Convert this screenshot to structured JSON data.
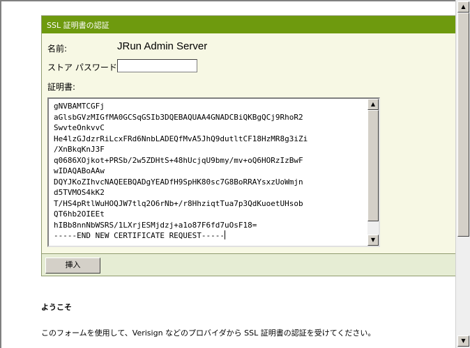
{
  "panel": {
    "title": "SSL 証明書の認証",
    "name_label": "名前:",
    "name_value": "JRun Admin Server",
    "password_label": "ストア パスワード:",
    "password_value": "",
    "certificate_label": "証明書:",
    "certificate_lines": [
      "gNVBAMTCGFj",
      "aGlsbGVzMIGfMA0GCSqGSIb3DQEBAQUAA4GNADCBiQKBgQCj9RhoR2",
      "SwvteOnkvvC",
      "He4lzGJdzrRiLcxFRd6NnbLADEQfMvA5JhQ9dutltCF18HzMR8g3iZi",
      "/XnBkqKnJ3F",
      "q0686XOjkot+PRSb/2w5ZDHtS+48hUcjqU9bmy/mv+oQ6HORzIzBwF",
      "wIDAQABoAAw",
      "DQYJKoZIhvcNAQEEBQADgYEADfH9SpHK80sc7G8BoRRAYsxzUoWmjn",
      "d5TVMOS4kK2",
      "T/HS4pRtlWuHOQJW7tlq2O6rNb+/r8HhziqtTua7p3QdKuoetUHsob",
      "QT6hb2OIEEt",
      "hIBb8nnNbWSRS/1LXrjESMjdzj+a1o87F6fd7uOsF18=",
      "-----END NEW CERTIFICATE REQUEST-----"
    ],
    "insert_button": "挿入"
  },
  "welcome": {
    "title": "ようこそ",
    "text": "このフォームを使用して、Verisign などのプロバイダから SSL 証明書の認証を受けてください。"
  },
  "icons": {
    "scroll_up": "up-arrow-icon",
    "scroll_down": "down-arrow-icon"
  }
}
